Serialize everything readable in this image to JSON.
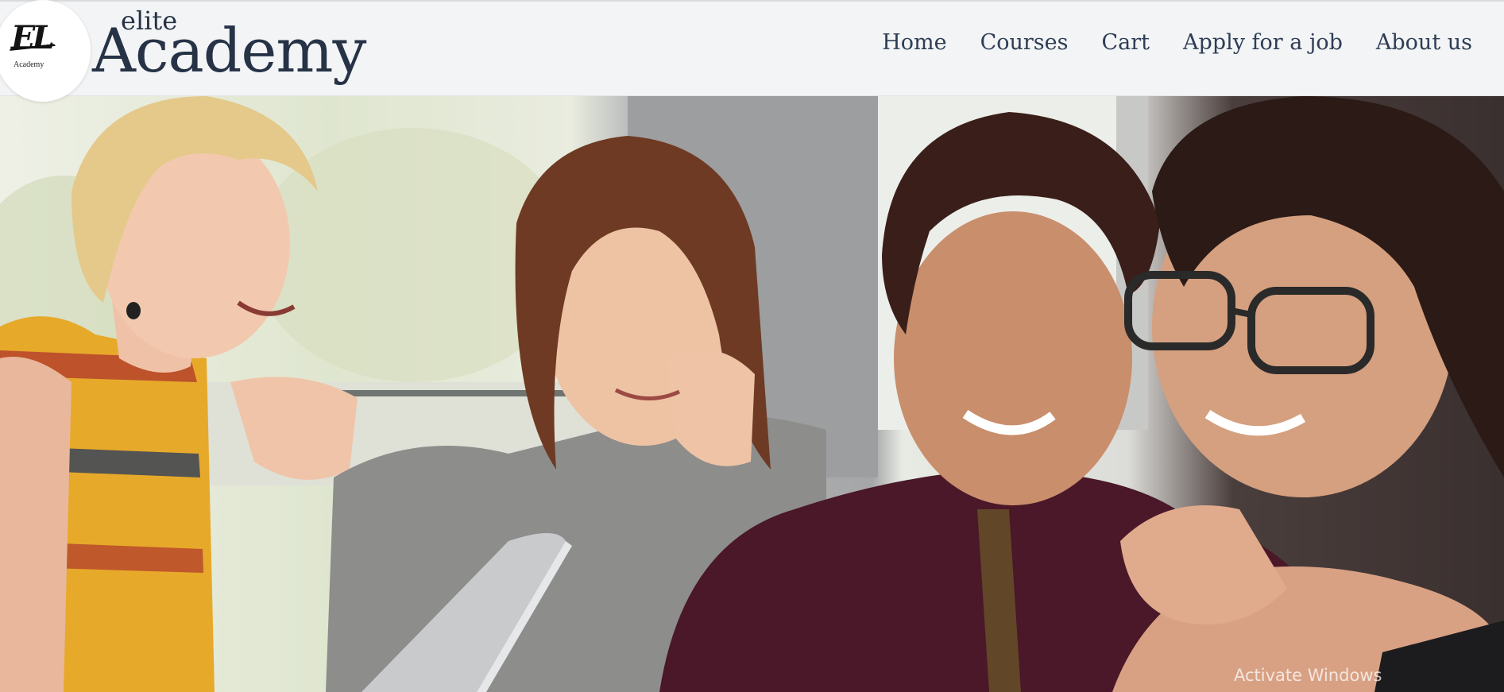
{
  "brand": {
    "logo_mark": "EL",
    "logo_mark_sub": "Academy",
    "small": "elite",
    "large": "Academy"
  },
  "nav": {
    "items": [
      {
        "label": "Home"
      },
      {
        "label": "Courses"
      },
      {
        "label": "Cart"
      },
      {
        "label": "Apply for a job"
      },
      {
        "label": "About us"
      }
    ]
  },
  "hero": {
    "image": "students-smiling-at-laptop-photo"
  },
  "os_overlay": {
    "watermark": "Activate Windows"
  },
  "colors": {
    "navbar_bg": "#f3f4f5",
    "brand_text": "#263246",
    "nav_text": "#2e3d55"
  }
}
